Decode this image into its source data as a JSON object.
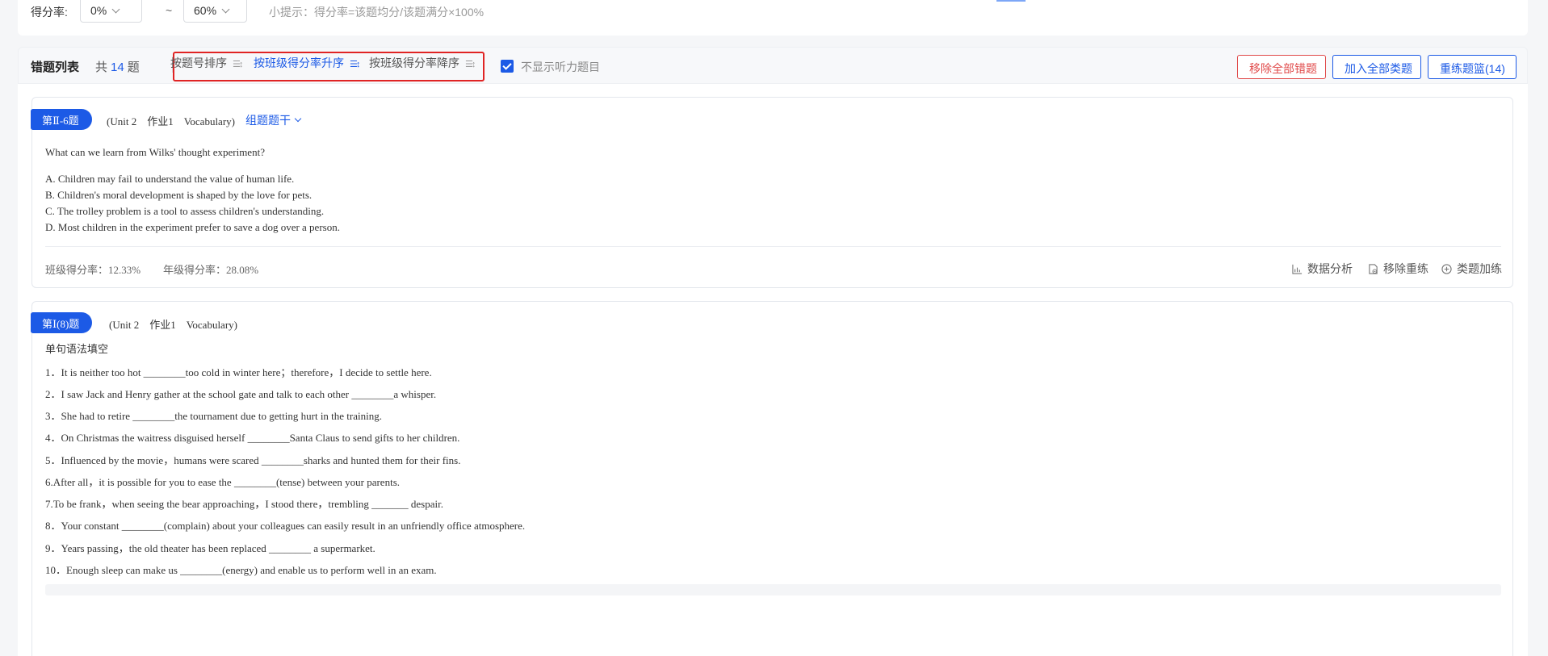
{
  "filter": {
    "label": "得分率:",
    "min_value": "0%",
    "separator": "~",
    "max_value": "60%",
    "tip": "小提示：得分率=该题均分/该题满分×100%"
  },
  "list_header": {
    "title": "错题列表",
    "count_prefix": "共",
    "count": "14",
    "count_suffix": "题",
    "sort_options": [
      {
        "label": "按题号排序",
        "active": false
      },
      {
        "label": "按班级得分率升序",
        "active": true
      },
      {
        "label": "按班级得分率降序",
        "active": false
      }
    ],
    "checkbox_label": "不显示听力题目",
    "checkbox_checked": true,
    "buttons": {
      "remove_all": "移除全部错题",
      "add_all": "加入全部类题",
      "retrain": "重练题篮(14)"
    }
  },
  "questions": [
    {
      "tag": "第Ⅱ-6题",
      "meta": "(Unit 2　作业1　Vocabulary)",
      "stem_toggle": "组题题干",
      "prompt": "What can we learn from Wilks' thought experiment?",
      "options": [
        "A. Children may fail to understand the value of human life.",
        "B. Children's moral development is shaped by the love for pets.",
        "C. The trolley problem is a tool to assess children's understanding.",
        "D. Most children in the experiment prefer to save a dog over a person."
      ],
      "class_rate_label": "班级得分率：",
      "class_rate": "12.33%",
      "grade_rate_label": "年级得分率：",
      "grade_rate": "28.08%",
      "actions": {
        "analysis": "数据分析",
        "remove": "移除重练",
        "similar": "类题加练"
      }
    },
    {
      "tag": "第Ⅰ(8)题",
      "meta": "(Unit 2　作业1　Vocabulary)",
      "instruction": "单句语法填空",
      "items": [
        "1．It is neither too hot ________too cold in winter here；therefore，I decide to settle here.",
        "2．I saw Jack and Henry gather at the school gate and talk to each other ________a whisper.",
        "3．She had to retire ________the tournament due to getting hurt in the training.",
        "4．On Christmas the waitress disguised herself ________Santa Claus to send gifts to her children.",
        "5．Influenced by the movie，humans were scared ________sharks and hunted them for their fins.",
        "6.After all，it is possible for you to ease the ________(tense) between your parents.",
        "7.To be frank，when seeing the bear approaching，I stood there，trembling _______ despair.",
        "8．Your constant ________(complain) about your colleagues can easily result in an unfriendly office atmosphere.",
        "9．Years passing，the old theater has been replaced ________ a supermarket.",
        "10．Enough sleep can make us ________(energy) and enable us to perform well in an exam."
      ]
    }
  ],
  "colors": {
    "accent": "#1c5ae6",
    "danger": "#e04a4a",
    "highlight_box": "#e02424"
  }
}
